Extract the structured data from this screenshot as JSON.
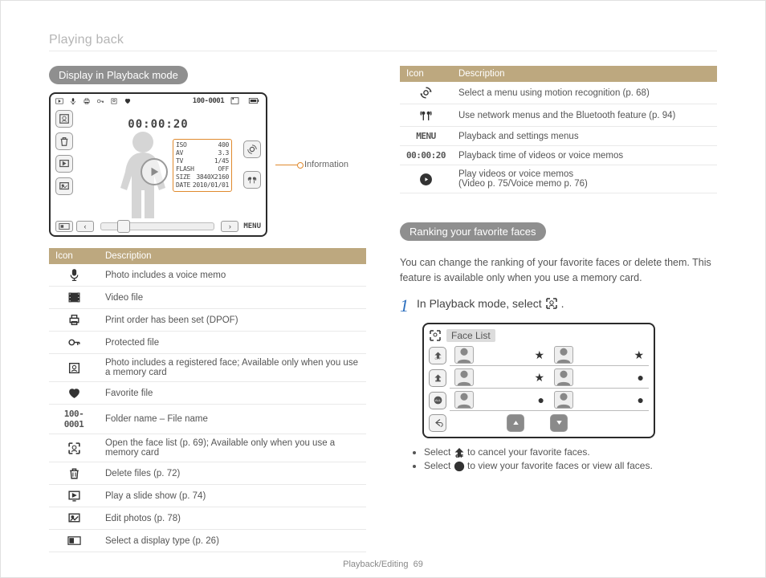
{
  "section_label": "Playing back",
  "footer_section": "Playback/Editing",
  "page_number": "69",
  "left": {
    "heading": "Display in Playback mode",
    "callout": "Information",
    "lcd": {
      "folder_file": "100-0001",
      "time": "00:00:20",
      "info": {
        "iso_k": "ISO",
        "iso_v": "400",
        "av_k": "AV",
        "av_v": "3.3",
        "tv_k": "TV",
        "tv_v": "1/45",
        "flash_k": "FLASH",
        "flash_v": "OFF",
        "size_k": "SIZE",
        "size_v": "3840X2160",
        "date_k": "DATE",
        "date_v": "2010/01/01"
      },
      "menu": "MENU"
    },
    "table": {
      "h_icon": "Icon",
      "h_desc": "Description",
      "rows": [
        {
          "icon": "mic-icon",
          "desc": "Photo includes a voice memo"
        },
        {
          "icon": "film-icon",
          "desc": "Video file"
        },
        {
          "icon": "printer-icon",
          "desc": "Print order has been set (DPOF)"
        },
        {
          "icon": "key-icon",
          "desc": "Protected file"
        },
        {
          "icon": "face-reg-icon",
          "desc": "Photo includes a registered face; Available only when you use a memory card"
        },
        {
          "icon": "heart-icon",
          "desc": "Favorite file"
        },
        {
          "icon": "folder-file-mono",
          "mono": "100-0001",
          "desc": "Folder name – File name"
        },
        {
          "icon": "face-list-icon",
          "desc": "Open the face list (p. 69); Available only when you use a memory card"
        },
        {
          "icon": "trash-icon",
          "desc": "Delete files (p. 72)"
        },
        {
          "icon": "slideshow-icon",
          "desc": "Play a slide show (p. 74)"
        },
        {
          "icon": "edit-photo-icon",
          "desc": "Edit photos (p. 78)"
        },
        {
          "icon": "display-type-icon",
          "desc": "Select a display type (p. 26)"
        }
      ]
    }
  },
  "right": {
    "table": {
      "h_icon": "Icon",
      "h_desc": "Description",
      "rows": [
        {
          "icon": "motion-icon",
          "desc": "Select a menu using motion recognition (p. 68)"
        },
        {
          "icon": "antenna-icon",
          "desc": "Use network menus and the Bluetooth feature (p. 94)"
        },
        {
          "icon": "menu-mono",
          "mono": "MENU",
          "desc": "Playback and settings menus"
        },
        {
          "icon": "time-mono",
          "mono": "00:00:20",
          "desc": "Playback time of videos or voice memos"
        },
        {
          "icon": "play-icon",
          "desc": "Play videos or voice memos\n(Video p. 75/Voice memo p. 76)"
        }
      ]
    },
    "heading": "Ranking your favorite faces",
    "intro": "You can change the ranking of your favorite faces or delete them. This feature is available only when you use a memory card.",
    "step_num": "1",
    "step_text_a": "In Playback mode, select ",
    "step_text_b": ".",
    "face_panel_title": "Face List",
    "bullets": [
      {
        "pre": "Select ",
        "icon": "home-off-icon",
        "post": " to cancel your favorite faces."
      },
      {
        "pre": "Select ",
        "icon": "all-faces-icon",
        "post": " to view your favorite faces or view all faces."
      }
    ]
  }
}
